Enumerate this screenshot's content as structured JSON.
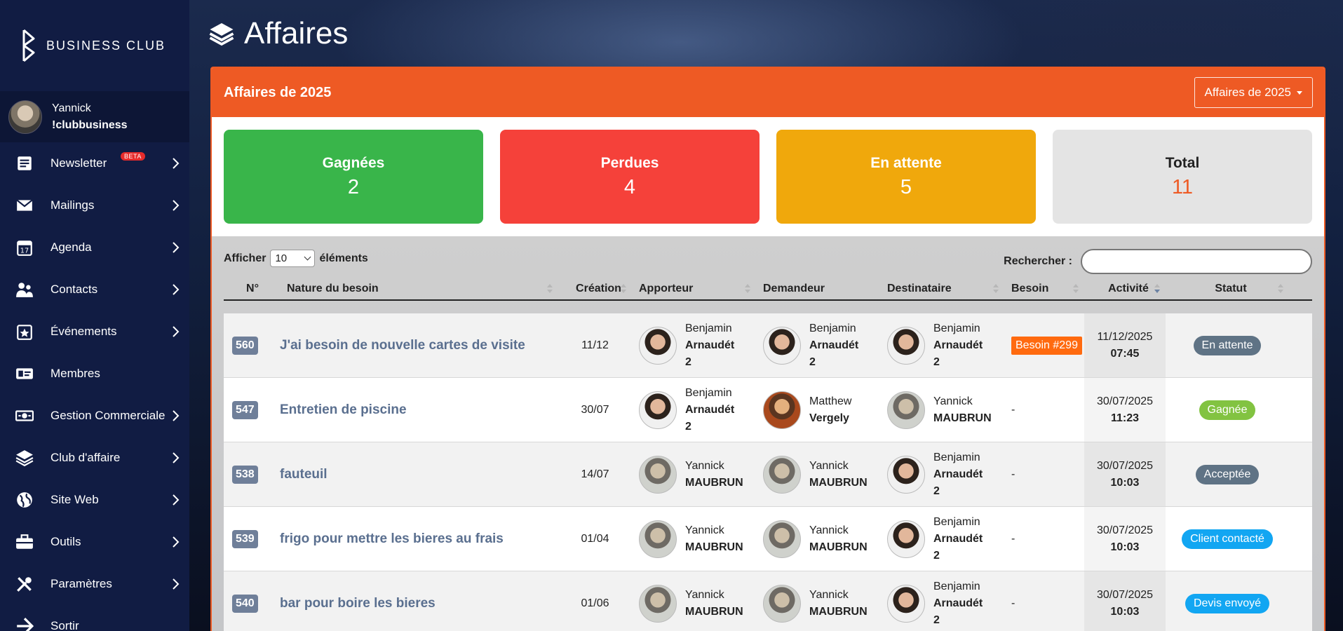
{
  "brand": {
    "name": "BUSINESS CLUB"
  },
  "user": {
    "first": "Yannick",
    "second": "!clubbusiness"
  },
  "menu": [
    {
      "label": "Newsletter",
      "icon": "newsletter-icon",
      "badge": "BETA"
    },
    {
      "label": "Mailings",
      "icon": "mail-icon"
    },
    {
      "label": "Agenda",
      "icon": "calendar-icon"
    },
    {
      "label": "Contacts",
      "icon": "contacts-icon"
    },
    {
      "label": "Événements",
      "icon": "event-icon"
    },
    {
      "label": "Membres",
      "icon": "id-card-icon"
    },
    {
      "label": "Gestion Commerciale",
      "icon": "money-icon"
    },
    {
      "label": "Club d'affaire",
      "icon": "layers-icon"
    },
    {
      "label": "Site Web",
      "icon": "globe-icon"
    },
    {
      "label": "Outils",
      "icon": "toolbox-icon"
    },
    {
      "label": "Paramètres",
      "icon": "tools-icon"
    },
    {
      "label": "Sortir",
      "icon": "exit-icon"
    }
  ],
  "page": {
    "title": "Affaires"
  },
  "panel": {
    "title": "Affaires de 2025",
    "dropdown": "Affaires de 2025"
  },
  "stats": {
    "won": {
      "label": "Gagnées",
      "value": "2"
    },
    "lost": {
      "label": "Perdues",
      "value": "4"
    },
    "wait": {
      "label": "En attente",
      "value": "5"
    },
    "total": {
      "label": "Total",
      "value": "11"
    }
  },
  "controls": {
    "show_label": "Afficher",
    "show_value": "10",
    "show_suffix": "éléments",
    "search_label": "Rechercher :"
  },
  "table": {
    "headers": {
      "num": "N°",
      "nature": "Nature du besoin",
      "creation": "Création",
      "apporteur": "Apporteur",
      "demandeur": "Demandeur",
      "destinataire": "Destinataire",
      "besoin": "Besoin",
      "activite": "Activité",
      "statut": "Statut"
    },
    "rows": [
      {
        "num": "560",
        "nature": "J'ai besoin de nouvelle cartes de visite",
        "creation": "11/12",
        "apporteur": {
          "first": "Benjamin",
          "last": "Arnaudét",
          "extra": "2"
        },
        "demandeur": {
          "first": "Benjamin",
          "last": "Arnaudét",
          "extra": "2"
        },
        "destinataire": {
          "first": "Benjamin",
          "last": "Arnaudét",
          "extra": "2"
        },
        "besoin": "Besoin #299",
        "act_date": "11/12/2025",
        "act_time": "07:45",
        "statut": "En attente"
      },
      {
        "num": "547",
        "nature": "Entretien de piscine",
        "creation": "30/07",
        "apporteur": {
          "first": "Benjamin",
          "last": "Arnaudét",
          "extra": "2"
        },
        "demandeur": {
          "first": "Matthew",
          "last": "Vergely",
          "extra": ""
        },
        "destinataire": {
          "first": "Yannick",
          "last": "MAUBRUN",
          "extra": ""
        },
        "besoin": "-",
        "act_date": "30/07/2025",
        "act_time": "11:23",
        "statut": "Gagnée"
      },
      {
        "num": "538",
        "nature": "fauteuil",
        "creation": "14/07",
        "apporteur": {
          "first": "Yannick",
          "last": "MAUBRUN",
          "extra": ""
        },
        "demandeur": {
          "first": "Yannick",
          "last": "MAUBRUN",
          "extra": ""
        },
        "destinataire": {
          "first": "Benjamin",
          "last": "Arnaudét",
          "extra": "2"
        },
        "besoin": "-",
        "act_date": "30/07/2025",
        "act_time": "10:03",
        "statut": "Acceptée"
      },
      {
        "num": "539",
        "nature": "frigo pour mettre les bieres au frais",
        "creation": "01/04",
        "apporteur": {
          "first": "Yannick",
          "last": "MAUBRUN",
          "extra": ""
        },
        "demandeur": {
          "first": "Yannick",
          "last": "MAUBRUN",
          "extra": ""
        },
        "destinataire": {
          "first": "Benjamin",
          "last": "Arnaudét",
          "extra": "2"
        },
        "besoin": "-",
        "act_date": "30/07/2025",
        "act_time": "10:03",
        "statut": "Client contacté"
      },
      {
        "num": "540",
        "nature": "bar pour boire les bieres",
        "creation": "01/06",
        "apporteur": {
          "first": "Yannick",
          "last": "MAUBRUN",
          "extra": ""
        },
        "demandeur": {
          "first": "Yannick",
          "last": "MAUBRUN",
          "extra": ""
        },
        "destinataire": {
          "first": "Benjamin",
          "last": "Arnaudét",
          "extra": "2"
        },
        "besoin": "-",
        "act_date": "30/07/2025",
        "act_time": "10:03",
        "statut": "Devis envoyé"
      }
    ]
  }
}
